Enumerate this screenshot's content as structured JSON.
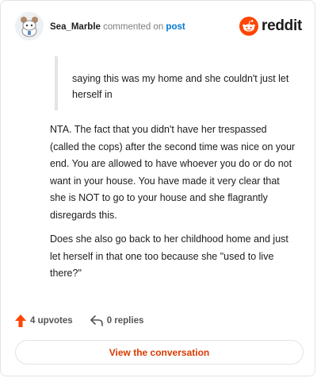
{
  "comment": {
    "username": "Sea_Marble",
    "action_text": "commented on",
    "post_link": "post",
    "quote": "saying this was my home and she couldn't just let herself in",
    "paragraphs": [
      "NTA. The fact that you didn't have her trespassed (called the cops) after the second time was nice on your end. You are allowed to have whoever you do or do not want in your house. You have made it very clear that she is NOT to go to your house and she flagrantly disregards this.",
      "Does she also go back to her childhood home and just let herself in that one too because she \"used to live there?\""
    ]
  },
  "brand": {
    "name": "reddit",
    "color": "#ff4500"
  },
  "stats": {
    "upvotes": "4 upvotes",
    "replies": "0 replies"
  },
  "cta": {
    "label": "View the conversation"
  },
  "colors": {
    "accent": "#ff4500",
    "link": "#0079d3",
    "cta_text": "#d93a00"
  },
  "icons": [
    "avatar-icon",
    "reddit-logo-icon",
    "upvote-arrow-icon",
    "reply-icon"
  ]
}
